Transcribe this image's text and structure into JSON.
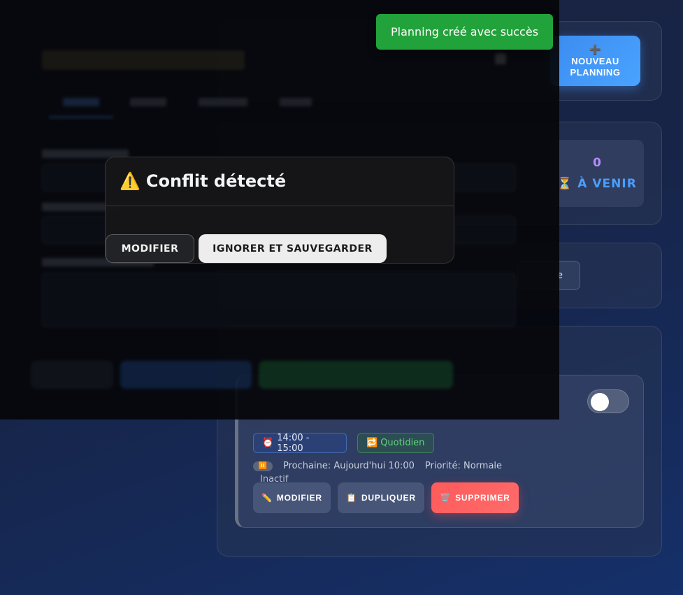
{
  "toast": {
    "message": "Planning créé avec succès"
  },
  "header": {
    "new_button_icon": "➕",
    "new_button_label": "NOUVEAU PLANNING"
  },
  "stats": {
    "upcoming_count": "0",
    "upcoming_icon": "⏳",
    "upcoming_label": "À VENIR"
  },
  "filter": {
    "visible_fragment": "e"
  },
  "conflict_dialog": {
    "warning_icon": "⚠️",
    "title": "Conflit détecté",
    "modify_label": "MODIFIER",
    "ignore_label": "IGNORER ET SAUVEGARDER"
  },
  "planning_item": {
    "time_icon": "⏰",
    "time_range": "14:00 - 15:00",
    "frequency_icon": "🔁",
    "frequency": "Quotidien",
    "status_icon": "⏸️",
    "next_run": "Prochaine: Aujourd'hui 10:00",
    "priority": "Priorité: Normale",
    "status": "Inactif",
    "active": false,
    "actions": {
      "edit_icon": "✏️",
      "edit_label": "MODIFIER",
      "duplicate_icon": "📋",
      "duplicate_label": "DUPLIQUER",
      "delete_icon": "🗑️",
      "delete_label": "SUPPRIMER"
    }
  },
  "colors": {
    "toast_bg": "#22a23a",
    "primary": "#3b8cf0",
    "danger": "#ff5a5a",
    "success_text": "#5ed47a",
    "upcoming_count": "#b68cff"
  }
}
